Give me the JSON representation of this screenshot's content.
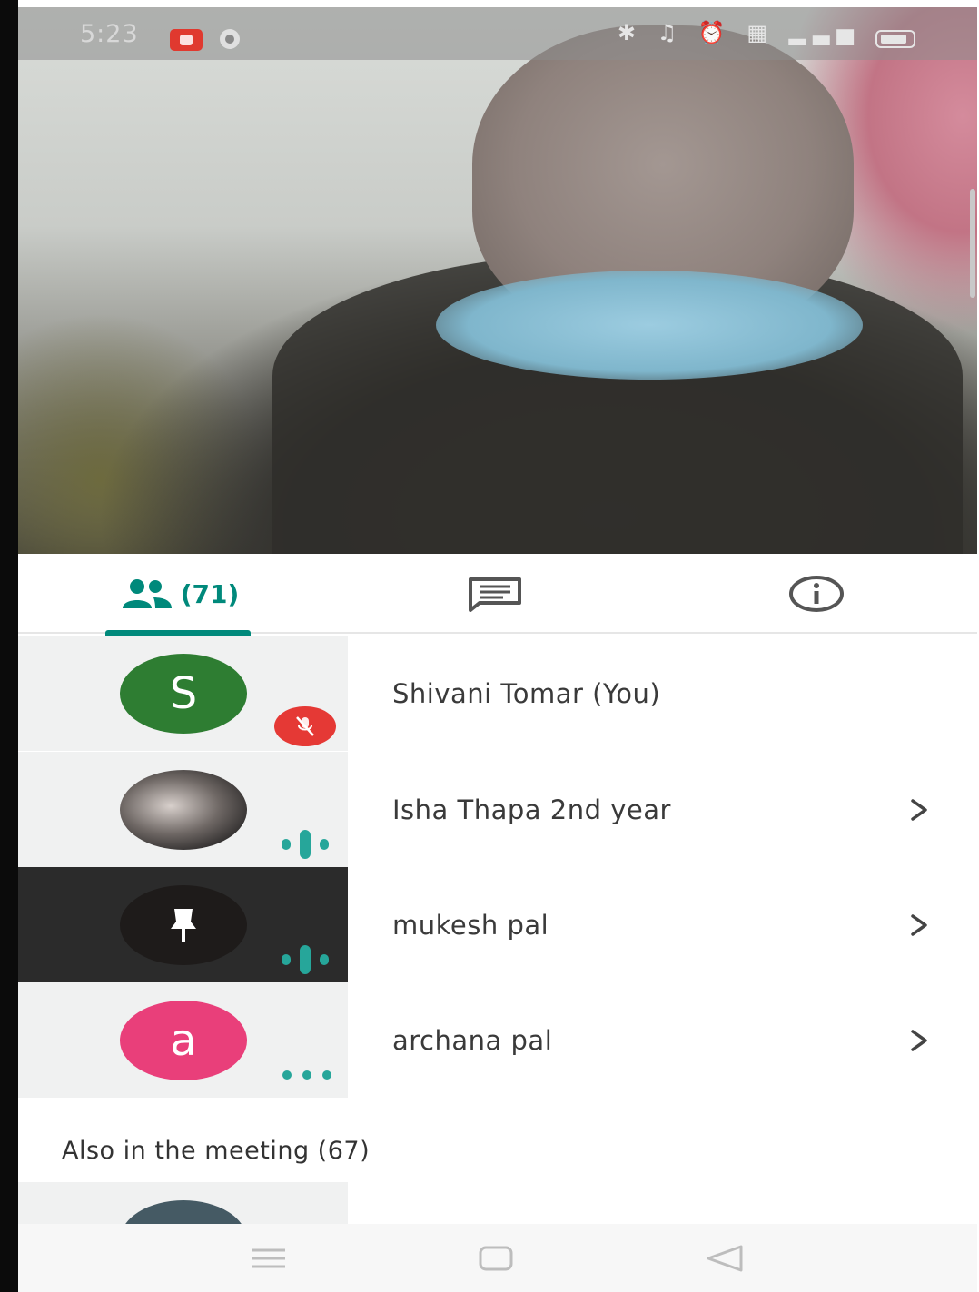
{
  "status_bar": {
    "time": "5:23",
    "icons": "✱ ♫ ⏰ ▦ ▂▃▅"
  },
  "tabs": {
    "people_count": "(71)",
    "chat_icon": "chat-bubble-icon",
    "info_icon": "info-icon"
  },
  "participants": [
    {
      "name": "Shivani Tomar (You)",
      "avatar_letter": "S",
      "avatar_color": "#2e7d32",
      "status": "muted"
    },
    {
      "name": "Isha Thapa 2nd year",
      "avatar_letter": "",
      "avatar_color": "#444444",
      "status": "speaking"
    },
    {
      "name": "mukesh pal",
      "avatar_letter": "",
      "avatar_color": "#1e1b1a",
      "status": "speaking",
      "pinned": true
    },
    {
      "name": "archana pal",
      "avatar_letter": "a",
      "avatar_color": "#e93f7a",
      "status": "more"
    }
  ],
  "also_in_meeting": "Also in the meeting (67)",
  "colors": {
    "accent": "#00897b",
    "speaking": "#26a69a",
    "muted": "#e53935"
  }
}
